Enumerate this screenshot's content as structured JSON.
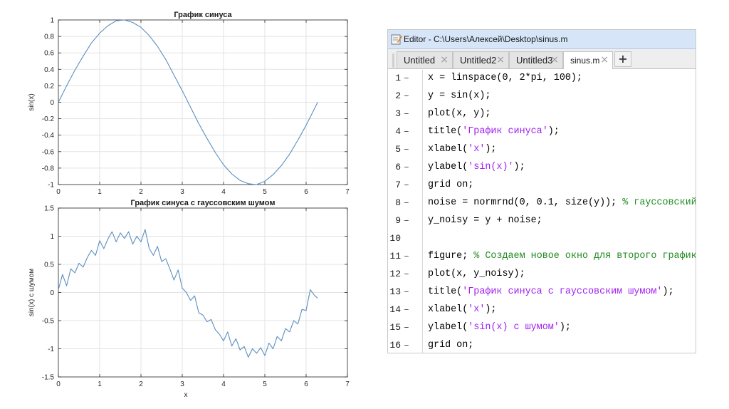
{
  "chart_data": [
    {
      "type": "line",
      "title": "График синуса",
      "xlabel": "",
      "ylabel": "sin(x)",
      "xlim": [
        0,
        7
      ],
      "ylim": [
        -1,
        1
      ],
      "xticks": [
        "0",
        "1",
        "2",
        "3",
        "4",
        "5",
        "6",
        "7"
      ],
      "yticks": [
        "-1",
        "-0.8",
        "-0.6",
        "-0.4",
        "-0.2",
        "0",
        "0.2",
        "0.4",
        "0.6",
        "0.8",
        "1"
      ],
      "grid": true,
      "line_color": "#5b8fbf",
      "series": [
        {
          "x": [
            0,
            0.2,
            0.4,
            0.6,
            0.8,
            1.0,
            1.2,
            1.4,
            1.6,
            1.8,
            2.0,
            2.2,
            2.4,
            2.6,
            2.8,
            3.0,
            3.2,
            3.4,
            3.6,
            3.8,
            4.0,
            4.2,
            4.4,
            4.6,
            4.8,
            5.0,
            5.2,
            5.4,
            5.6,
            5.8,
            6.0,
            6.2,
            6.28
          ],
          "y": [
            0,
            0.2,
            0.39,
            0.56,
            0.72,
            0.84,
            0.93,
            0.99,
            1.0,
            0.97,
            0.91,
            0.81,
            0.68,
            0.52,
            0.33,
            0.14,
            -0.06,
            -0.26,
            -0.44,
            -0.61,
            -0.76,
            -0.87,
            -0.95,
            -0.99,
            -1.0,
            -0.96,
            -0.88,
            -0.77,
            -0.63,
            -0.46,
            -0.28,
            -0.08,
            0
          ]
        }
      ]
    },
    {
      "type": "line",
      "title": "График синуса с гауссовским шумом",
      "xlabel": "x",
      "ylabel": "sin(x) с шумом",
      "xlim": [
        0,
        7
      ],
      "ylim": [
        -1.5,
        1.5
      ],
      "xticks": [
        "0",
        "1",
        "2",
        "3",
        "4",
        "5",
        "6",
        "7"
      ],
      "yticks": [
        "-1.5",
        "-1",
        "-0.5",
        "0",
        "0.5",
        "1",
        "1.5"
      ],
      "grid": true,
      "line_color": "#5b8fbf",
      "series": [
        {
          "x": [
            0,
            0.1,
            0.2,
            0.3,
            0.4,
            0.5,
            0.6,
            0.7,
            0.8,
            0.9,
            1.0,
            1.1,
            1.2,
            1.3,
            1.4,
            1.5,
            1.6,
            1.7,
            1.8,
            1.9,
            2.0,
            2.1,
            2.2,
            2.3,
            2.4,
            2.5,
            2.6,
            2.7,
            2.8,
            2.9,
            3.0,
            3.1,
            3.2,
            3.3,
            3.4,
            3.5,
            3.6,
            3.7,
            3.8,
            3.9,
            4.0,
            4.1,
            4.2,
            4.3,
            4.4,
            4.5,
            4.6,
            4.7,
            4.8,
            4.9,
            5.0,
            5.1,
            5.2,
            5.3,
            5.4,
            5.5,
            5.6,
            5.7,
            5.8,
            5.9,
            6.0,
            6.1,
            6.2,
            6.28
          ],
          "y": [
            0.05,
            0.32,
            0.12,
            0.42,
            0.35,
            0.52,
            0.45,
            0.62,
            0.75,
            0.66,
            0.92,
            0.78,
            0.95,
            1.08,
            0.9,
            1.06,
            0.96,
            1.08,
            0.86,
            1.0,
            0.9,
            1.12,
            0.78,
            0.66,
            0.82,
            0.55,
            0.6,
            0.42,
            0.22,
            0.4,
            0.08,
            0.0,
            -0.14,
            -0.06,
            -0.36,
            -0.4,
            -0.52,
            -0.48,
            -0.66,
            -0.74,
            -0.86,
            -0.7,
            -0.95,
            -0.82,
            -1.02,
            -0.96,
            -1.15,
            -1.0,
            -1.08,
            -0.98,
            -1.12,
            -0.9,
            -1.0,
            -0.78,
            -0.86,
            -0.64,
            -0.7,
            -0.5,
            -0.56,
            -0.3,
            -0.32,
            0.05,
            -0.05,
            -0.1
          ]
        }
      ]
    }
  ],
  "editor": {
    "title": "Editor - C:\\Users\\Алексей\\Desktop\\sinus.m",
    "tabs": [
      {
        "label": "Untitled",
        "close": "×"
      },
      {
        "label": "Untitled2",
        "close": "×"
      },
      {
        "label": "Untitled3",
        "close": "×"
      },
      {
        "label": "sinus.m",
        "close": "×"
      }
    ],
    "add_tab": "+",
    "line_dash": "–",
    "lines": [
      {
        "num": "1",
        "parts": [
          {
            "t": "x = linspace(0, 2*pi, 100);",
            "k": "code"
          }
        ]
      },
      {
        "num": "2",
        "parts": [
          {
            "t": "y = sin(x);",
            "k": "code"
          }
        ]
      },
      {
        "num": "3",
        "parts": [
          {
            "t": "plot(x, y);",
            "k": "code"
          }
        ]
      },
      {
        "num": "4",
        "parts": [
          {
            "t": "title(",
            "k": "code"
          },
          {
            "t": "'График синуса'",
            "k": "str"
          },
          {
            "t": ");",
            "k": "code"
          }
        ]
      },
      {
        "num": "5",
        "parts": [
          {
            "t": "xlabel(",
            "k": "code"
          },
          {
            "t": "'x'",
            "k": "str"
          },
          {
            "t": ");",
            "k": "code"
          }
        ]
      },
      {
        "num": "6",
        "parts": [
          {
            "t": "ylabel(",
            "k": "code"
          },
          {
            "t": "'sin(x)'",
            "k": "str"
          },
          {
            "t": ");",
            "k": "code"
          }
        ]
      },
      {
        "num": "7",
        "parts": [
          {
            "t": "grid on;",
            "k": "code"
          }
        ]
      },
      {
        "num": "8",
        "parts": [
          {
            "t": "noise = normrnd(0, 0.1, size(y)); ",
            "k": "code"
          },
          {
            "t": "% гауссовский шум",
            "k": "com"
          }
        ]
      },
      {
        "num": "9",
        "parts": [
          {
            "t": "y_noisy = y + noise;",
            "k": "code"
          }
        ]
      },
      {
        "num": "10",
        "parts": []
      },
      {
        "num": "11",
        "parts": [
          {
            "t": "figure; ",
            "k": "code"
          },
          {
            "t": "% Создаем новое окно для второго графика",
            "k": "com"
          }
        ]
      },
      {
        "num": "12",
        "parts": [
          {
            "t": "plot(x, y_noisy);",
            "k": "code"
          }
        ]
      },
      {
        "num": "13",
        "parts": [
          {
            "t": "title(",
            "k": "code"
          },
          {
            "t": "'График синуса с гауссовским шумом'",
            "k": "str"
          },
          {
            "t": ");",
            "k": "code"
          }
        ]
      },
      {
        "num": "14",
        "parts": [
          {
            "t": "xlabel(",
            "k": "code"
          },
          {
            "t": "'x'",
            "k": "str"
          },
          {
            "t": ");",
            "k": "code"
          }
        ]
      },
      {
        "num": "15",
        "parts": [
          {
            "t": "ylabel(",
            "k": "code"
          },
          {
            "t": "'sin(x) с шумом'",
            "k": "str"
          },
          {
            "t": ");",
            "k": "code"
          }
        ]
      },
      {
        "num": "16",
        "parts": [
          {
            "t": "grid on;",
            "k": "code"
          }
        ]
      }
    ]
  }
}
